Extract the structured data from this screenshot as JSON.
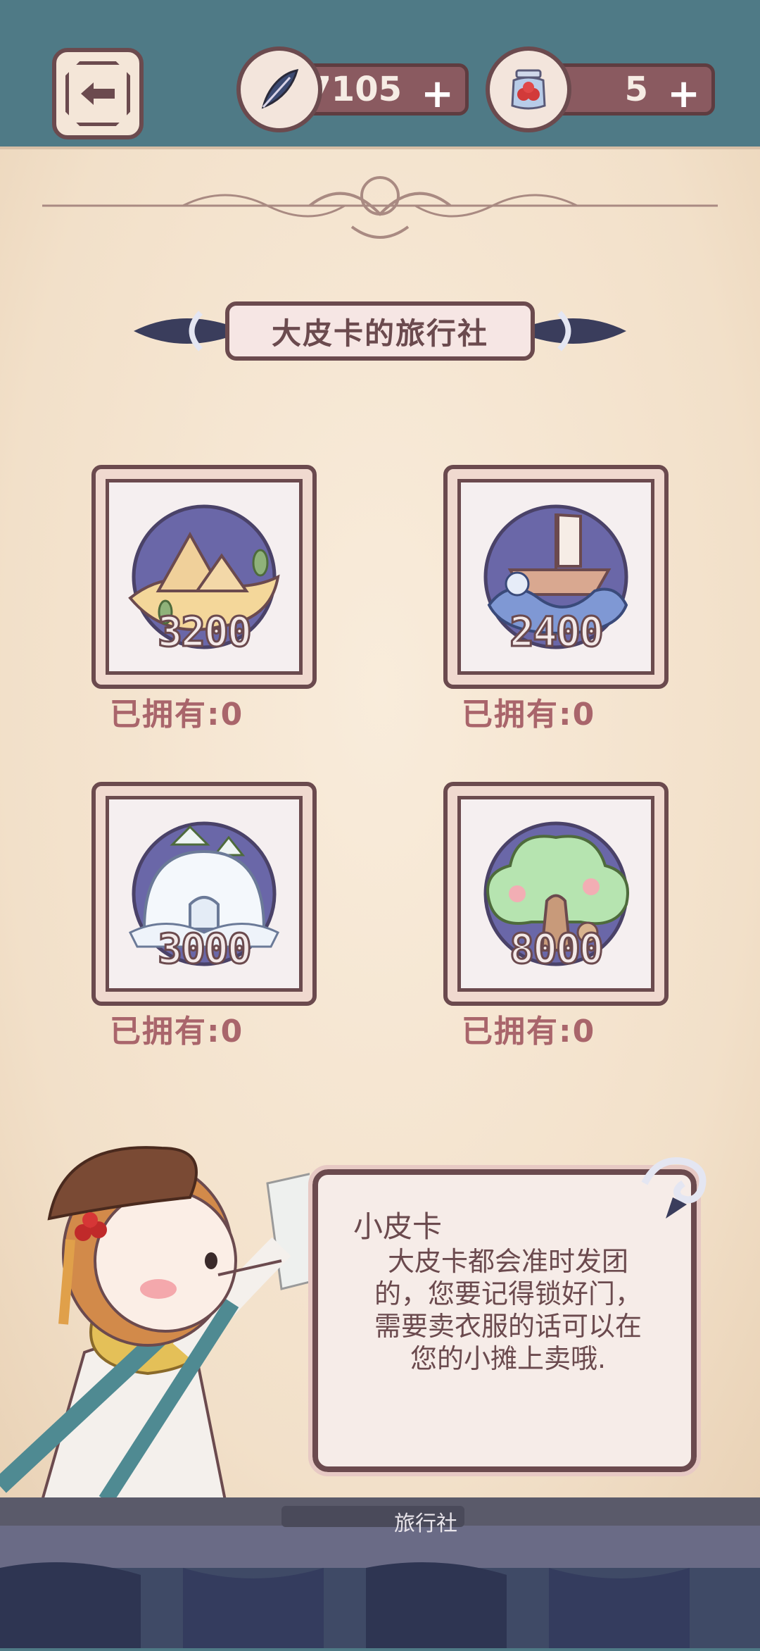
{
  "currency": {
    "feather": {
      "amount": "7105",
      "plus": "+"
    },
    "jar": {
      "amount": "5",
      "plus": "+"
    }
  },
  "title": "大皮卡的旅行社",
  "cards": [
    {
      "price": "3200",
      "owned": "已拥有:0",
      "icon": "desert-pyramids"
    },
    {
      "price": "2400",
      "owned": "已拥有:0",
      "icon": "sailboat-waves"
    },
    {
      "price": "3000",
      "owned": "已拥有:0",
      "icon": "igloo-snow"
    },
    {
      "price": "8000",
      "owned": "已拥有:0",
      "icon": "forest-tree"
    }
  ],
  "dialog": {
    "speaker": "小皮卡",
    "text": "大皮卡都会准时发团的，您要记得锁好门，需要卖衣服的话可以在您的小摊上卖哦."
  },
  "stall_label": "旅行社",
  "colors": {
    "frame": "#6b4a4e",
    "panel": "#f2e0c9",
    "topbar": "#4f7a86"
  }
}
